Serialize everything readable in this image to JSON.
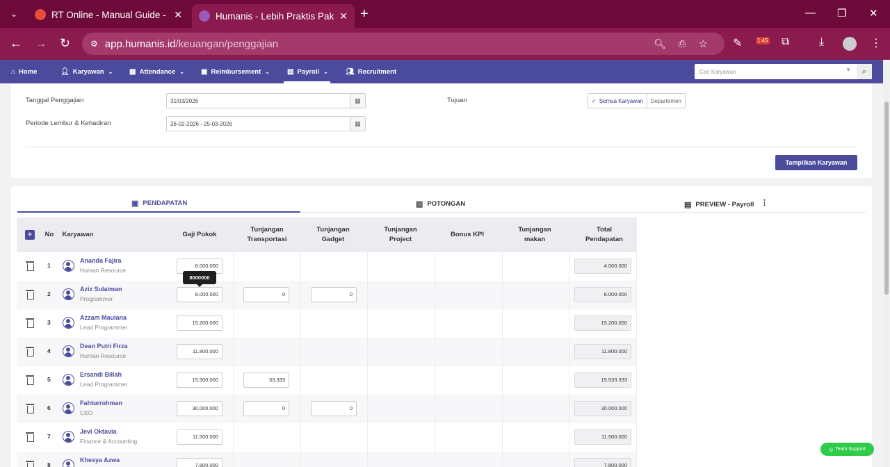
{
  "browser": {
    "tabs": [
      {
        "title": "RT Online - Manual Guide - Xm",
        "active": false,
        "favicon_color": "#e94b3c"
      },
      {
        "title": "Humanis - Lebih Praktis Pakai H",
        "active": true,
        "favicon_color": "#9b59b6"
      }
    ],
    "url_host": "app.humanis.id",
    "url_path": "/keuangan/penggajian",
    "badge_time": "1:45",
    "accent": "#8b1a4e"
  },
  "nav": {
    "items": [
      {
        "label": "Home",
        "icon": "home-icon"
      },
      {
        "label": "Karyawan",
        "icon": "users-icon"
      },
      {
        "label": "Attendance",
        "icon": "calendar-icon"
      },
      {
        "label": "Reimbursement",
        "icon": "cash-icon"
      },
      {
        "label": "Payroll",
        "icon": "wallet-icon"
      },
      {
        "label": "Recruitment",
        "icon": "people-icon"
      }
    ],
    "search_placeholder": "Cari Karyawan",
    "color": "#4b4b9e"
  },
  "form": {
    "tanggal_label": "Tanggal Penggajian",
    "tanggal_value": "31/03/2026",
    "periode_label": "Periode Lembur & Kehadiran",
    "periode_value": "26-02-2026 - 25-03-2026",
    "tujuan_label": "Tujuan",
    "tujuan_opt1": "Semua Karyawan",
    "tujuan_opt2": "Departemen",
    "show_button": "Tampilkan Karyawan"
  },
  "tabs": {
    "pendapatan": "PENDAPATAN",
    "potongan": "POTONGAN",
    "preview": "PREVIEW - Payroll"
  },
  "table": {
    "headers": {
      "no": "No",
      "karyawan": "Karyawan",
      "gaji": "Gaji Pokok",
      "transport": "Tunjangan Transportasi",
      "gadget": "Tunjangan Gadget",
      "project": "Tunjangan Project",
      "bonus": "Bonus KPI",
      "makan": "Tunjangan makan",
      "total": "Total Pendapatan"
    },
    "rows": [
      {
        "no": "1",
        "name": "Ananda Fajira",
        "role": "Human Resource",
        "gaji": "8.000.000",
        "transport": null,
        "gadget": null,
        "total": "4.000.000"
      },
      {
        "no": "2",
        "name": "Aziz Sulaiman",
        "role": "Programmer",
        "gaji": "8.000.000",
        "transport": "0",
        "gadget": "0",
        "total": "8.000.000"
      },
      {
        "no": "3",
        "name": "Azzam Maulana",
        "role": "Lead Programmer",
        "gaji": "15.200.000",
        "transport": null,
        "gadget": null,
        "total": "15.200.000"
      },
      {
        "no": "4",
        "name": "Dean Putri Firza",
        "role": "Human Resource",
        "gaji": "11.800.000",
        "transport": null,
        "gadget": null,
        "total": "11.800.000"
      },
      {
        "no": "5",
        "name": "Ersandi Billah",
        "role": "Lead Programmer",
        "gaji": "15.500.000",
        "transport": "33.333",
        "gadget": null,
        "total": "15.533.333"
      },
      {
        "no": "6",
        "name": "Fahturrohman",
        "role": "CEO",
        "gaji": "30.000.000",
        "transport": "0",
        "gadget": "0",
        "total": "30.000.000"
      },
      {
        "no": "7",
        "name": "Jevi Oktavia",
        "role": "Finance & Accounting",
        "gaji": "11.500.000",
        "transport": null,
        "gadget": null,
        "total": "11.500.000"
      },
      {
        "no": "8",
        "name": "Khesya Azwa",
        "role": "",
        "gaji": "7.800.000",
        "transport": null,
        "gadget": null,
        "total": "7.800.000"
      }
    ]
  },
  "tooltip": "8000000",
  "support_label": "Team Support"
}
